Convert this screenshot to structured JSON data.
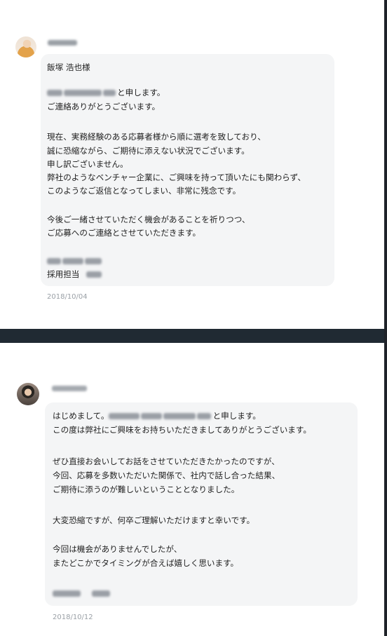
{
  "message1": {
    "sender_name": "",
    "greeting": "飯塚 浩也様",
    "intro_suffix": "と申します。",
    "thanks": "ご連絡ありがとうございます。",
    "body1": [
      "現在、実務経験のある応募者様から順に選考を致しており、",
      "誠に恐縮ながら、ご期待に添えない状況でございます。",
      "申し訳ございません。",
      "弊社のようなベンチャー企業に、ご興味を持って頂いたにも関わらず、",
      "このようなご返信となってしまい、非常に残念です。"
    ],
    "body2": [
      "今後ご一緒させていただく機会があることを祈りつつ、",
      "ご応募へのご連絡とさせていただきます。"
    ],
    "signature_role": "採用担当",
    "date": "2018/10/04"
  },
  "message2": {
    "sender_name": "",
    "intro_prefix": "はじめまして。",
    "intro_suffix": "と申します。",
    "thanks": "この度は弊社にご興味をお持ちいただきましてありがとうございます。",
    "body1": [
      "ぜひ直接お会いしてお話をさせていただきたかったのですが、",
      "今回、応募を多数いただいた関係で、社内で話し合った結果、",
      "ご期待に添うのが難しいということとなりました。"
    ],
    "body2": "大変恐縮ですが、何卒ご理解いただけますと幸いです。",
    "body3": [
      "今回は機会がありませんでしたが、",
      "またどこかでタイミングが合えば嬉しく思います。"
    ],
    "date": "2018/10/12"
  },
  "colors": {
    "bubble": "#f4f5f6",
    "divider": "#202a33",
    "date": "#9aa0a6"
  }
}
